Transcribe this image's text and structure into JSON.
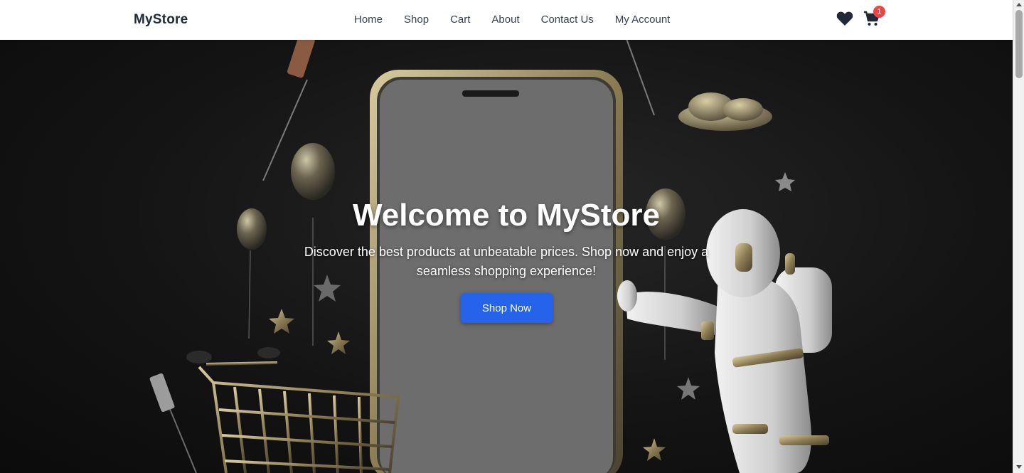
{
  "header": {
    "brand": "MyStore",
    "nav": [
      {
        "label": "Home"
      },
      {
        "label": "Shop"
      },
      {
        "label": "Cart"
      },
      {
        "label": "About"
      },
      {
        "label": "Contact Us"
      },
      {
        "label": "My Account"
      }
    ],
    "icons": {
      "wishlist": "heart-icon",
      "cart": "shopping-cart-icon"
    },
    "cart_count": "1"
  },
  "hero": {
    "title": "Welcome to MyStore",
    "subtitle": "Discover the best products at unbeatable prices. Shop now and enjoy a seamless shopping experience!",
    "cta_label": "Shop Now"
  },
  "colors": {
    "accent": "#2563eb",
    "badge": "#ef4444",
    "nav_text": "#374151",
    "hero_background": "#141414"
  }
}
